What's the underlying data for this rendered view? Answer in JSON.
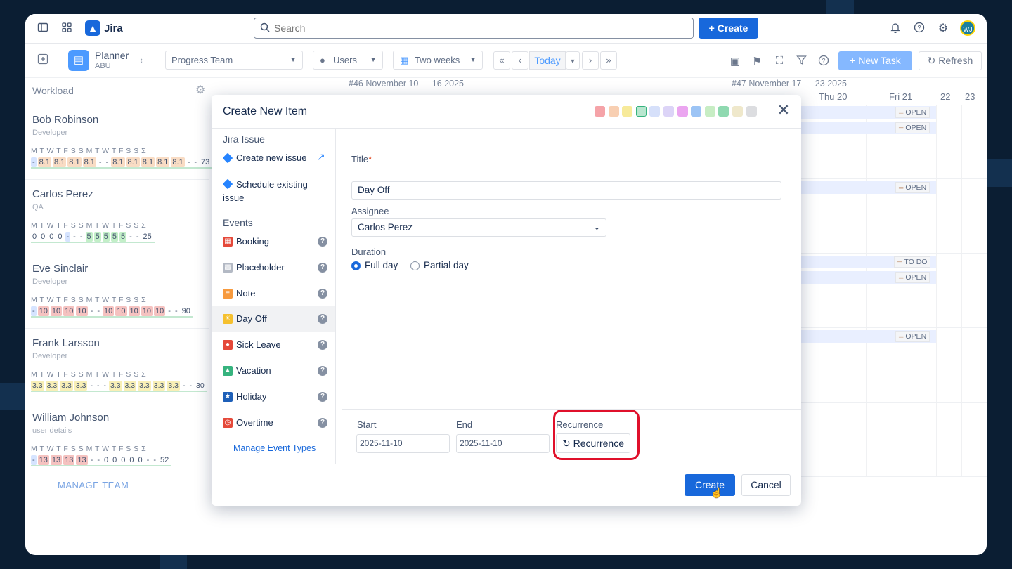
{
  "app": {
    "name": "Jira",
    "avatar_initials": "WJ"
  },
  "search": {
    "placeholder": "Search"
  },
  "top": {
    "create_label": "Create"
  },
  "toolbar": {
    "planner_title": "Planner",
    "planner_sub": "ABU",
    "team": "Progress Team",
    "users": "Users",
    "period": "Two weeks",
    "today": "Today",
    "new_task": "New Task",
    "refresh": "Refresh"
  },
  "workload": {
    "title": "Workload",
    "people": [
      {
        "name": "Bob Robinson",
        "role": "Developer",
        "days": "M T W T F S S M T W T F S S Σ",
        "values": [
          "-",
          "8.1",
          "8.1",
          "8.1",
          "8.1",
          "-",
          "-",
          "8.1",
          "8.1",
          "8.1",
          "8.1",
          "8.1",
          "-",
          "-",
          "73"
        ]
      },
      {
        "name": "Carlos Perez",
        "role": "QA",
        "days": "M T W T F S S M T W T F S S Σ",
        "values": [
          "0",
          "0",
          "0",
          "0",
          "-",
          "-",
          "-",
          "5",
          "5",
          "5",
          "5",
          "5",
          "-",
          "-",
          "25"
        ]
      },
      {
        "name": "Eve Sinclair",
        "role": "Developer",
        "days": "M T W T F S S M T W T F S S Σ",
        "values": [
          "-",
          "10",
          "10",
          "10",
          "10",
          "-",
          "-",
          "10",
          "10",
          "10",
          "10",
          "10",
          "-",
          "-",
          "90"
        ]
      },
      {
        "name": "Frank Larsson",
        "role": "Developer",
        "days": "M T W T F S S M T W T F S S Σ",
        "values": [
          "3.3",
          "3.3",
          "3.3",
          "3.3",
          "-",
          "-",
          "-",
          "3.3",
          "3.3",
          "3.3",
          "3.3",
          "3.3",
          "-",
          "-",
          "30"
        ]
      },
      {
        "name": "William Johnson",
        "role": "user details",
        "days": "M T W T F S S M T W T F S S Σ",
        "values": [
          "-",
          "13",
          "13",
          "13",
          "13",
          "-",
          "-",
          "0",
          "0",
          "0",
          "0",
          "0",
          "-",
          "-",
          "52"
        ]
      }
    ],
    "manage_team": "MANAGE TEAM"
  },
  "calendar": {
    "week1": "#46 November 10 — 16 2025",
    "week2": "#47 November 17 — 23 2025",
    "days": [
      "Thu 20",
      "Fri 21",
      "22",
      "23"
    ],
    "statuses": [
      "OPEN",
      "OPEN",
      "OPEN",
      "TO DO",
      "OPEN",
      "OPEN"
    ]
  },
  "modal": {
    "title": "Create New Item",
    "swatches": [
      "#f5a3a8",
      "#f8cfb2",
      "#f7ea9a",
      "#b8e6cf",
      "#d6e0fa",
      "#dcd4f7",
      "#eba5f0",
      "#9cc4f5",
      "#c7edc4",
      "#8fd9b0",
      "#efe8cb",
      "#dcdde0"
    ],
    "jira_section": "Jira Issue",
    "create_new_issue": "Create new issue",
    "schedule_existing": "Schedule existing issue",
    "events_section": "Events",
    "events": [
      {
        "label": "Booking",
        "color": "#e5493a",
        "icon": "calendar-icon"
      },
      {
        "label": "Placeholder",
        "color": "#b3b9c4",
        "icon": "placeholder-icon"
      },
      {
        "label": "Note",
        "color": "#f79a3e",
        "icon": "note-icon"
      },
      {
        "label": "Day Off",
        "color": "#f5c02e",
        "icon": "sun-icon"
      },
      {
        "label": "Sick Leave",
        "color": "#e5493a",
        "icon": "pill-icon"
      },
      {
        "label": "Vacation",
        "color": "#36b37e",
        "icon": "palm-icon"
      },
      {
        "label": "Holiday",
        "color": "#1d5fb8",
        "icon": "star-icon"
      },
      {
        "label": "Overtime",
        "color": "#e5493a",
        "icon": "clock-icon"
      }
    ],
    "manage_event_types": "Manage Event Types",
    "title_label": "Title",
    "title_value": "Day Off",
    "assignee_label": "Assignee",
    "assignee_value": "Carlos Perez",
    "duration_label": "Duration",
    "full_day": "Full day",
    "partial_day": "Partial day",
    "start_label": "Start",
    "start_value": "2025-11-10",
    "end_label": "End",
    "end_value": "2025-11-10",
    "recurrence_label": "Recurrence",
    "recurrence_button": "Recurrence",
    "create_button": "Create",
    "cancel_button": "Cancel"
  }
}
